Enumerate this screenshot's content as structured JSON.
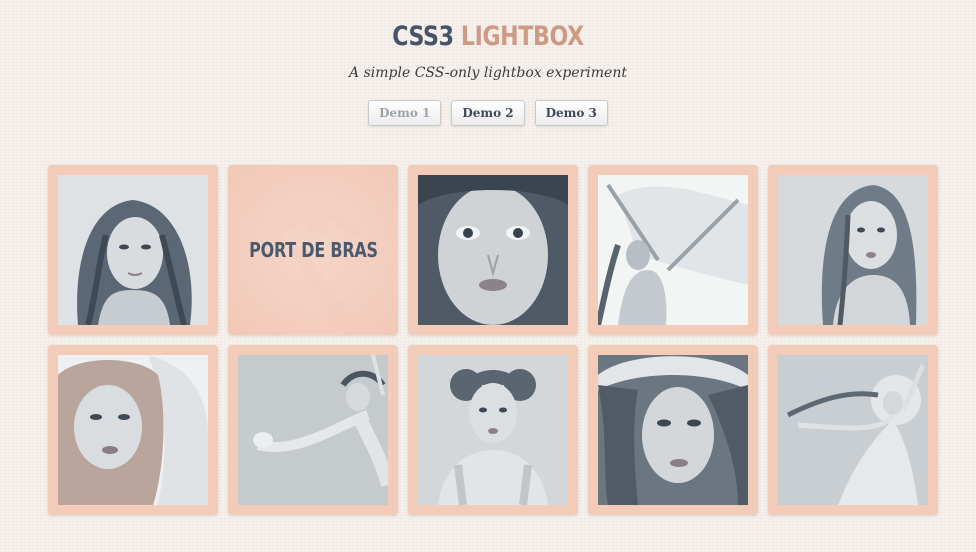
{
  "header": {
    "title_part1": "CSS3",
    "title_part2": "LIGHTBOX",
    "subtitle": "A simple CSS-only lightbox experiment",
    "title_color_1": "#475467",
    "title_color_2": "#cf9a84"
  },
  "demos": [
    {
      "label": "Demo 1",
      "active": true
    },
    {
      "label": "Demo 2",
      "active": false
    },
    {
      "label": "Demo 3",
      "active": false
    }
  ],
  "gallery": {
    "frame_color": "#f2cbb9",
    "hovered_tile_label": "PORT DE BRAS",
    "tiles": [
      {
        "icon": "portrait-photo-icon",
        "tone": "#8a97a3"
      },
      {
        "icon": "dancer-photo-icon",
        "tone": "#e9cfc2"
      },
      {
        "icon": "portrait-photo-icon",
        "tone": "#7d8995"
      },
      {
        "icon": "dancer-photo-icon",
        "tone": "#c4cad0"
      },
      {
        "icon": "portrait-photo-icon",
        "tone": "#9aa4ad"
      },
      {
        "icon": "portrait-photo-icon",
        "tone": "#c8ccd0"
      },
      {
        "icon": "dancer-photo-icon",
        "tone": "#b9bdbf"
      },
      {
        "icon": "portrait-photo-icon",
        "tone": "#a6abaf"
      },
      {
        "icon": "portrait-photo-icon",
        "tone": "#6f7b86"
      },
      {
        "icon": "dancer-photo-icon",
        "tone": "#b2b9bf"
      }
    ]
  }
}
